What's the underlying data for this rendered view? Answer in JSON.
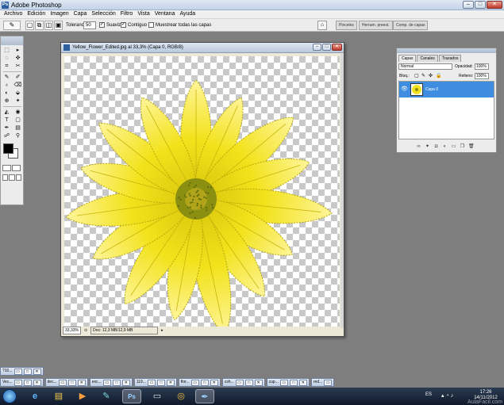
{
  "window": {
    "title": "Adobe Photoshop",
    "icon_name": "photoshop-app-icon",
    "controls": [
      "–",
      "□",
      "✕"
    ]
  },
  "menu": [
    "Archivo",
    "Edición",
    "Imagen",
    "Capa",
    "Selección",
    "Filtro",
    "Vista",
    "Ventana",
    "Ayuda"
  ],
  "options_bar": {
    "tool_glyph": "✎",
    "tolerance_label": "Tolerancia:",
    "tolerance_value": "50",
    "antialias_label": "Suavizar",
    "antialias_checked": true,
    "contiguous_label": "Contiguo",
    "contiguous_checked": true,
    "sample_all_label": "Muestrear todas las capas",
    "sample_all_checked": false,
    "well_tabs": [
      "Pinceles",
      "Herram. preest.",
      "Comp. de capas"
    ]
  },
  "toolbox": {
    "tools": [
      "⬚",
      "▸",
      "◌",
      "✜",
      "⌗",
      "✂",
      "✎",
      "✐",
      "♁",
      "⌫",
      "◐",
      "⬙",
      "⊕",
      "✦",
      "◭",
      "◉",
      "T",
      "▢",
      "✒",
      "▤",
      "☍",
      "⚲",
      "✋",
      "🔍"
    ],
    "foreground_color": "#000000",
    "background_color": "#ffffff"
  },
  "document": {
    "title": "Yellow_Flower_Edited.jpg al 33,3% (Capa 0, RGB/8)",
    "zoom": "33,33%",
    "doc_info": "Doc: 12,3 MB/12,9 MB",
    "image": {
      "petal_color": "#f2e21b",
      "petal_edge": "#b8a70a",
      "center_color": "#8a8f12"
    }
  },
  "layers_panel": {
    "tabs": [
      "Capas",
      "Canales",
      "Trazados"
    ],
    "active_tab": "Capas",
    "blend_mode": "Normal",
    "opacity_label": "Opacidad:",
    "opacity_value": "100%",
    "lock_label": "Bloq.:",
    "fill_label": "Relleno:",
    "fill_value": "100%",
    "layer": {
      "name": "Capa 0",
      "visible": true
    },
    "footer_icons": [
      "link-icon",
      "fx-icon",
      "mask-icon",
      "adjustment-icon",
      "group-icon",
      "new-layer-icon",
      "trash-icon"
    ],
    "footer_glyphs": [
      "∞",
      "✦",
      "◘",
      "◐",
      "▭",
      "❐",
      "🗑"
    ]
  },
  "minimized_docs": [
    {
      "label": "?10..."
    }
  ],
  "window_strip": [
    {
      "label": "Vec..."
    },
    {
      "label": "dec..."
    },
    {
      "label": "exc..."
    },
    {
      "label": "119..."
    },
    {
      "label": "flor..."
    },
    {
      "label": "csh..."
    },
    {
      "label": "cup..."
    },
    {
      "label": "red..."
    }
  ],
  "taskbar": {
    "apps": [
      {
        "name": "internet-explorer-icon",
        "glyph": "e",
        "active": false
      },
      {
        "name": "file-explorer-icon",
        "glyph": "▤",
        "active": false
      },
      {
        "name": "media-player-icon",
        "glyph": "▶",
        "active": false
      },
      {
        "name": "paint-icon",
        "glyph": "✎",
        "active": false
      },
      {
        "name": "photoshop-icon",
        "glyph": "Ps",
        "active": true
      },
      {
        "name": "scanner-icon",
        "glyph": "▭",
        "active": false
      },
      {
        "name": "chrome-icon",
        "glyph": "◎",
        "active": false
      },
      {
        "name": "pen-tool-icon",
        "glyph": "✒",
        "active": true
      }
    ],
    "language": "ES",
    "time": "17:26",
    "date": "14/11/2012",
    "watermark": "AulaFacil.com"
  }
}
